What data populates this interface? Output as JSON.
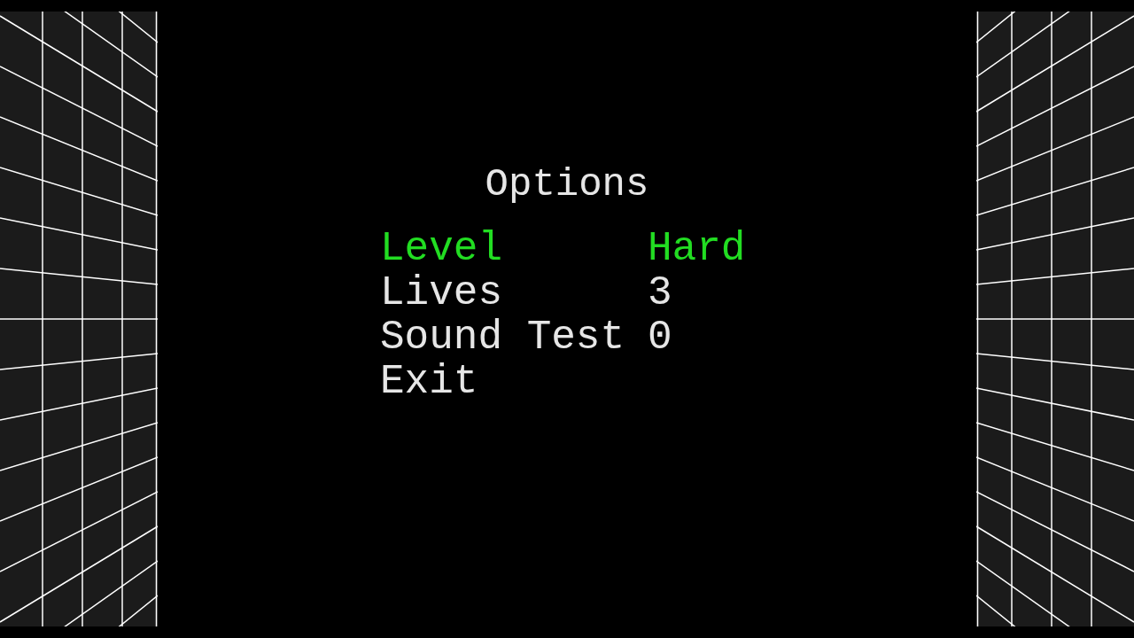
{
  "title": "Options",
  "items": [
    {
      "label": "Level",
      "value": "Hard",
      "selected": true
    },
    {
      "label": "Lives",
      "value": "3",
      "selected": false
    },
    {
      "label": "Sound Test",
      "value": "0",
      "selected": false
    },
    {
      "label": "Exit",
      "selected": false
    }
  ]
}
